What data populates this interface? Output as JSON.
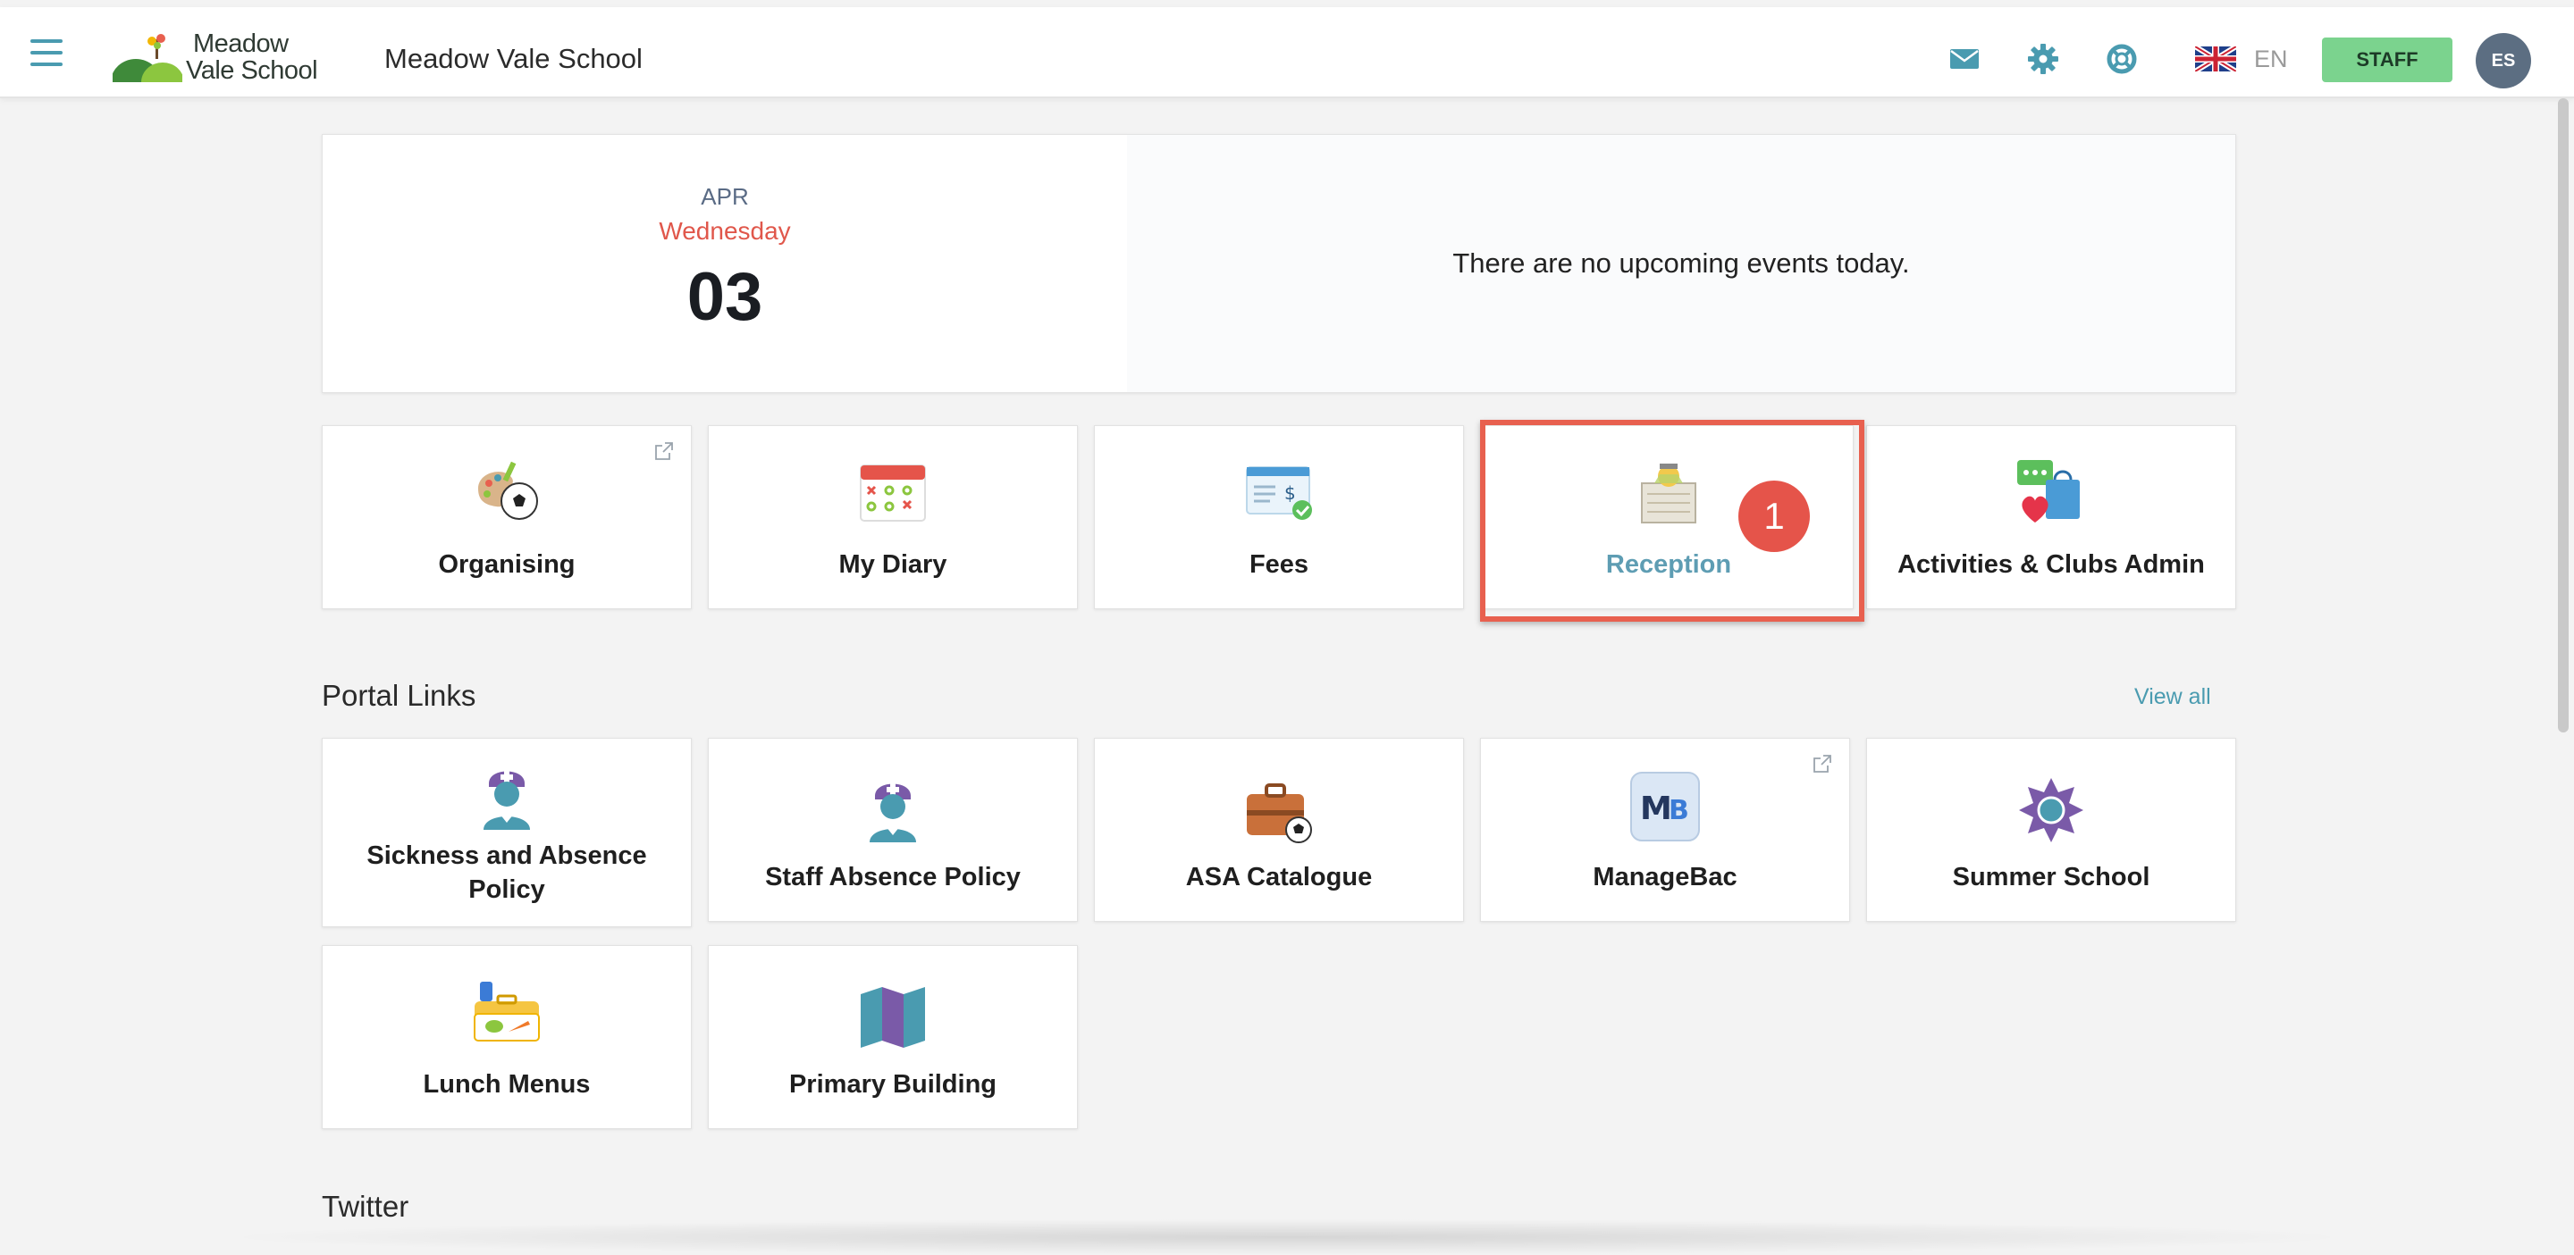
{
  "header": {
    "logo_line1": "Meadow",
    "logo_line2": "Vale School",
    "school_name": "Meadow Vale School",
    "icons": [
      "envelope-icon",
      "gear-icon",
      "lifebuoy-icon"
    ],
    "language": "EN",
    "role_button": "STAFF",
    "avatar_initials": "ES"
  },
  "date_card": {
    "month": "APR",
    "weekday": "Wednesday",
    "day": "03",
    "events_message": "There are no upcoming events today."
  },
  "apps": [
    {
      "label": "Organising",
      "icon": "sports-palette-icon",
      "external": true
    },
    {
      "label": "My Diary",
      "icon": "calendar-icon",
      "external": false
    },
    {
      "label": "Fees",
      "icon": "invoice-icon",
      "external": false
    },
    {
      "label": "Reception",
      "icon": "reception-desk-icon",
      "external": false
    },
    {
      "label": "Activities & Clubs Admin",
      "icon": "chat-shopping-bag-icon",
      "external": false
    }
  ],
  "annotation": {
    "step_number": "1",
    "highlight_color": "#e8604f"
  },
  "portal_links": {
    "title": "Portal Links",
    "view_all": "View all",
    "items": [
      {
        "label": "Sickness and Absence Policy",
        "icon": "nurse-icon",
        "external": false
      },
      {
        "label": "Staff Absence Policy",
        "icon": "nurse-icon",
        "external": false
      },
      {
        "label": "ASA Catalogue",
        "icon": "sports-bag-icon",
        "external": false
      },
      {
        "label": "ManageBac",
        "icon": "managebac-logo-icon",
        "external": true
      },
      {
        "label": "Summer School",
        "icon": "sun-icon",
        "external": false
      },
      {
        "label": "Lunch Menus",
        "icon": "lunchbox-icon",
        "external": false
      },
      {
        "label": "Primary Building",
        "icon": "map-icon",
        "external": false
      }
    ]
  },
  "twitter": {
    "title": "Twitter"
  },
  "colors": {
    "accent": "#4a9bb0",
    "staff_green": "#7bd38e",
    "weekday_red": "#e0574b",
    "avatar": "#5c6e82"
  }
}
